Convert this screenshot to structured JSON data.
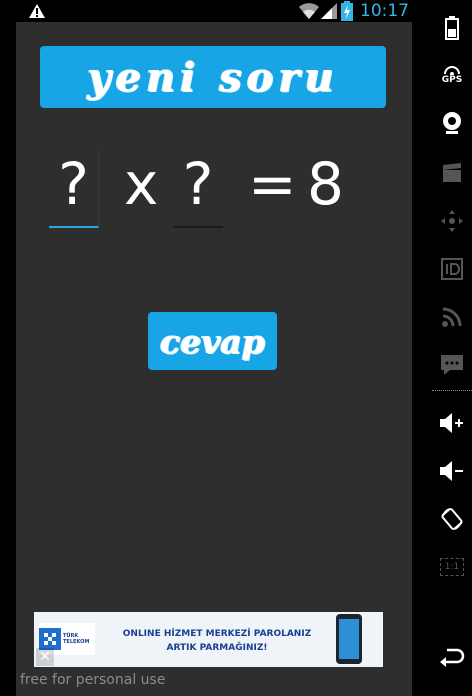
{
  "status_bar": {
    "time": "10:17",
    "icons": [
      "warning-icon",
      "wifi-icon",
      "signal-icon",
      "battery-charging-icon"
    ]
  },
  "app": {
    "new_question_label": "yeni soru",
    "equation": {
      "first_operand": "?",
      "operator": "x",
      "second_operand": "?",
      "equals": "=",
      "result": "8"
    },
    "answer_label": "cevap"
  },
  "ad": {
    "brand_text": "TÜRK TELEKOM",
    "message_line1": "ONLINE HİZMET MERKEZİ PAROLANIZ",
    "message_line2": "ARTIK PARMAĞINIZ!",
    "close_symbol": "✕",
    "watermark": "free for personal use"
  },
  "nav": {
    "gps_label": "GPS",
    "zoom_label": "1:1",
    "icons": [
      "battery-icon",
      "gps-icon",
      "webcam-icon",
      "clapper-icon",
      "dpad-icon",
      "id-icon",
      "rss-icon",
      "sms-icon",
      "volume-up-icon",
      "volume-down-icon",
      "rotate-icon",
      "zoom-icon",
      "back-icon"
    ]
  },
  "colors": {
    "accent": "#18a5e6",
    "app_background": "#2e2e2e",
    "clock": "#33b5e5"
  }
}
